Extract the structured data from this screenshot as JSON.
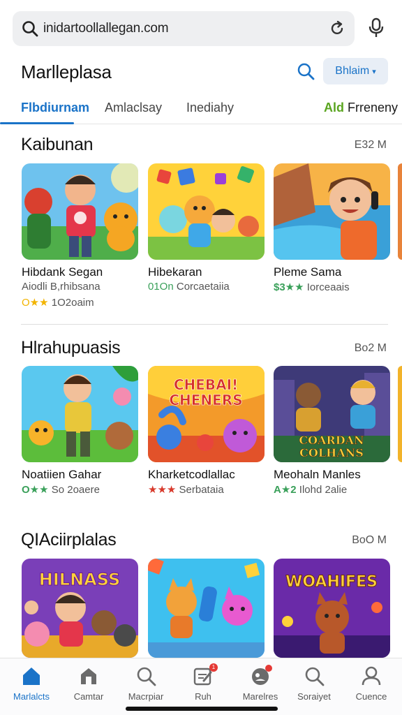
{
  "address_bar": {
    "url": "inidartoollallegan.com"
  },
  "header": {
    "title": "Marlleplasa",
    "button_label": "Bhlaim"
  },
  "tabs": [
    {
      "label": "Flbdiurnam",
      "active": true
    },
    {
      "label": "Amlaclsay",
      "active": false
    },
    {
      "label": "Inediahy",
      "active": false
    },
    {
      "prefix": "Ald",
      "label": "Frreneny",
      "active": false
    }
  ],
  "sections": [
    {
      "title": "Kaibunan",
      "more": "E32 M",
      "cards": [
        {
          "title": "Hibdank Segan",
          "sub": "Aiodli B,rhibsana",
          "stars": "★★",
          "star_prefix": "O",
          "rating_text": "1O2oaim"
        },
        {
          "title": "Hibekaran",
          "sub_prefix": "01On",
          "sub": "Corcaetaiia"
        },
        {
          "title": "Pleme Sama",
          "stars": "$3★★",
          "sub": "Iorceaais"
        }
      ]
    },
    {
      "title": "Hlrahupuasis",
      "more": "Bo2 M",
      "cards": [
        {
          "title": "Noatiien Gahar",
          "stars": "O★★",
          "sub": "So 2oaere",
          "art_text": ""
        },
        {
          "title": "Kharketcodlallac",
          "stars": "★★★",
          "sub": "Serbataia",
          "art_text": "CHEBAI! CHENERS"
        },
        {
          "title": "Meohaln Manles",
          "stars": "A★2",
          "sub": "Ilohd 2alie",
          "art_text": "COARDAN COLHANS"
        }
      ]
    },
    {
      "title": "QIAciirplalas",
      "more": "BoO M",
      "cards": [
        {
          "art_text": "HILNASS"
        },
        {
          "art_text": ""
        },
        {
          "art_text": "WOAHIFES"
        }
      ]
    }
  ],
  "bottom_nav": [
    {
      "label": "Marlalcts",
      "icon": "home-icon",
      "active": true
    },
    {
      "label": "Camtar",
      "icon": "store-icon",
      "active": false
    },
    {
      "label": "Macrpiar",
      "icon": "search-icon",
      "active": false
    },
    {
      "label": "Ruh",
      "icon": "edit-icon",
      "active": false,
      "badge": "1"
    },
    {
      "label": "Marelres",
      "icon": "people-icon",
      "active": false
    },
    {
      "label": "Soraiyet",
      "icon": "magnifier-icon",
      "active": false
    },
    {
      "label": "Cuence",
      "icon": "account-icon",
      "active": false
    }
  ],
  "colors": {
    "accent": "#1a73c8",
    "star_gold": "#f2b400",
    "star_red": "#d8392b",
    "star_green": "#3aa05a",
    "badge_red": "#e53935"
  }
}
